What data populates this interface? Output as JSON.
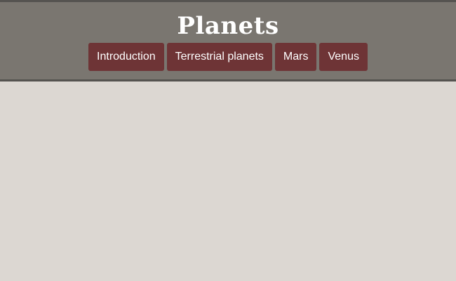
{
  "header": {
    "title": "Planets",
    "nav": [
      {
        "label": "Introduction"
      },
      {
        "label": "Terrestrial planets"
      },
      {
        "label": "Mars"
      },
      {
        "label": "Venus"
      }
    ]
  },
  "colors": {
    "header_bg": "#7a7670",
    "header_border": "#555350",
    "nav_button_bg": "#6e3436",
    "page_bg": "#dcd7d2",
    "text_light": "#ffffff"
  }
}
